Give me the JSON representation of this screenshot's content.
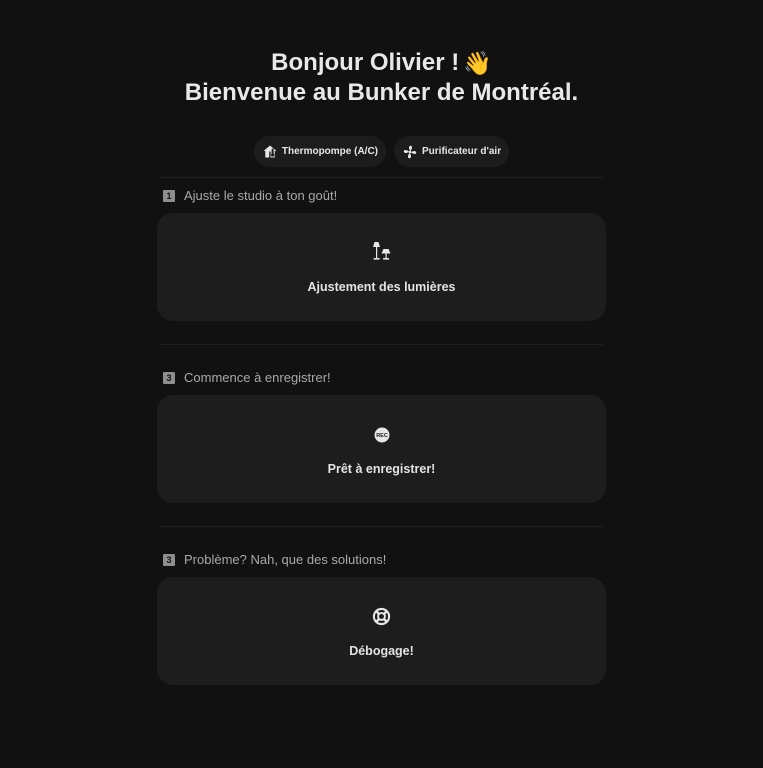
{
  "header": {
    "greeting": "Bonjour Olivier !",
    "wave_emoji": "👋",
    "welcome": "Bienvenue au Bunker de Montréal."
  },
  "chips": [
    {
      "label": "Thermopompe (A/C)",
      "icon": "home-thermostat-icon"
    },
    {
      "label": "Purificateur d'air",
      "icon": "fan-icon"
    }
  ],
  "sections": [
    {
      "number": "1",
      "title": "Ajuste le studio à ton goût!",
      "card_label": "Ajustement des lumières",
      "icon": "floor-lamp-icon"
    },
    {
      "number": "3",
      "title": "Commence à enregistrer!",
      "card_label": "Prêt à enregistrer!",
      "icon": "record-rec-icon"
    },
    {
      "number": "3",
      "title": "Problème? Nah, que des solutions!",
      "card_label": "Débogage!",
      "icon": "lifebuoy-icon"
    }
  ],
  "colors": {
    "background": "#111112",
    "card": "#1d1d1e",
    "text": "#e3e3e3",
    "muted": "#a9a9a9"
  }
}
